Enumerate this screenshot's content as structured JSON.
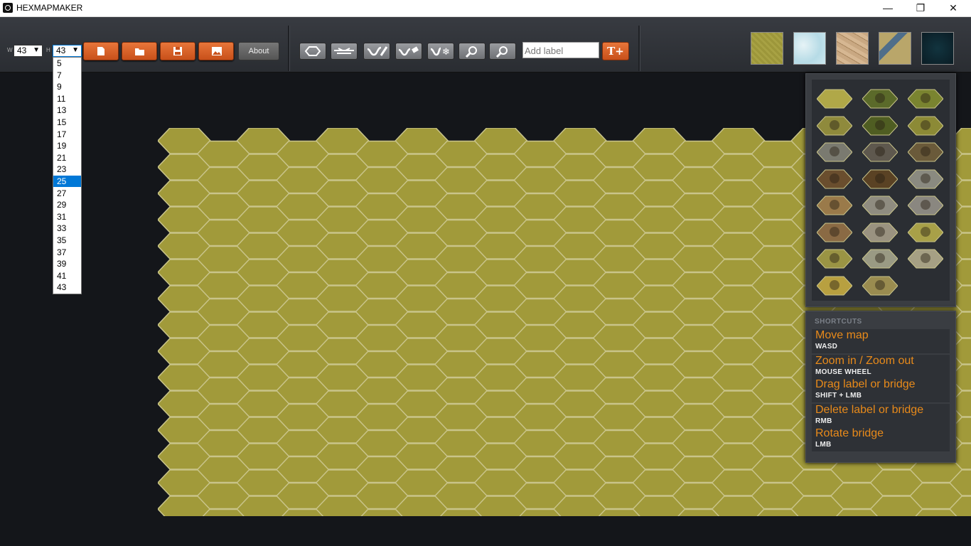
{
  "window": {
    "title": "HEXMAPMAKER",
    "controls": {
      "minimize": "—",
      "restore": "❐",
      "close": "✕"
    }
  },
  "toolbar": {
    "width_label": "W",
    "height_label": "H",
    "width_value": "43",
    "height_value": "43",
    "buttons": {
      "new": "new-file-icon",
      "open": "open-folder-icon",
      "save": "save-icon",
      "export": "image-icon",
      "about": "About"
    },
    "tools": [
      "hex-tool-icon",
      "bridge-tool-icon",
      "road-tool-icon",
      "road-eraser-icon",
      "river-tool-icon",
      "zoom-in-icon",
      "zoom-out-icon"
    ],
    "label_placeholder": "Add label",
    "add_label_button": "T+",
    "terrain_swatches": [
      "grass",
      "ice",
      "desert",
      "river",
      "deep-water"
    ]
  },
  "height_dropdown": {
    "options": [
      "5",
      "7",
      "9",
      "11",
      "13",
      "15",
      "17",
      "19",
      "21",
      "23",
      "25",
      "27",
      "29",
      "31",
      "33",
      "35",
      "37",
      "39",
      "41",
      "43"
    ],
    "highlighted": "25"
  },
  "palette": {
    "tiles": [
      "plain",
      "forest",
      "pine-forest",
      "hills-grass",
      "deep-forest",
      "shrubs",
      "mountain",
      "skull-mountain",
      "volcano",
      "cave",
      "dark-cave",
      "castle",
      "village",
      "fortress",
      "stone-castle",
      "town",
      "keep",
      "tower",
      "lighthouse",
      "ruins",
      "colosseum",
      "wheat-field",
      "farm"
    ]
  },
  "shortcuts": {
    "header": "SHORTCUTS",
    "items": [
      {
        "action": "Move map",
        "key": "WASD"
      },
      {
        "action": "Zoom in / Zoom out",
        "key": "MOUSE WHEEL"
      },
      {
        "action": "Drag label or bridge",
        "key": "SHIFT + LMB"
      },
      {
        "action": "Delete label or bridge",
        "key": "RMB"
      },
      {
        "action": "Rotate bridge",
        "key": "LMB"
      }
    ]
  },
  "colors": {
    "hex_fill": "#a19a3a",
    "hex_edge": "#c9c48a",
    "accent_orange": "#d9622a",
    "shortcut_text": "#e88a1a"
  }
}
